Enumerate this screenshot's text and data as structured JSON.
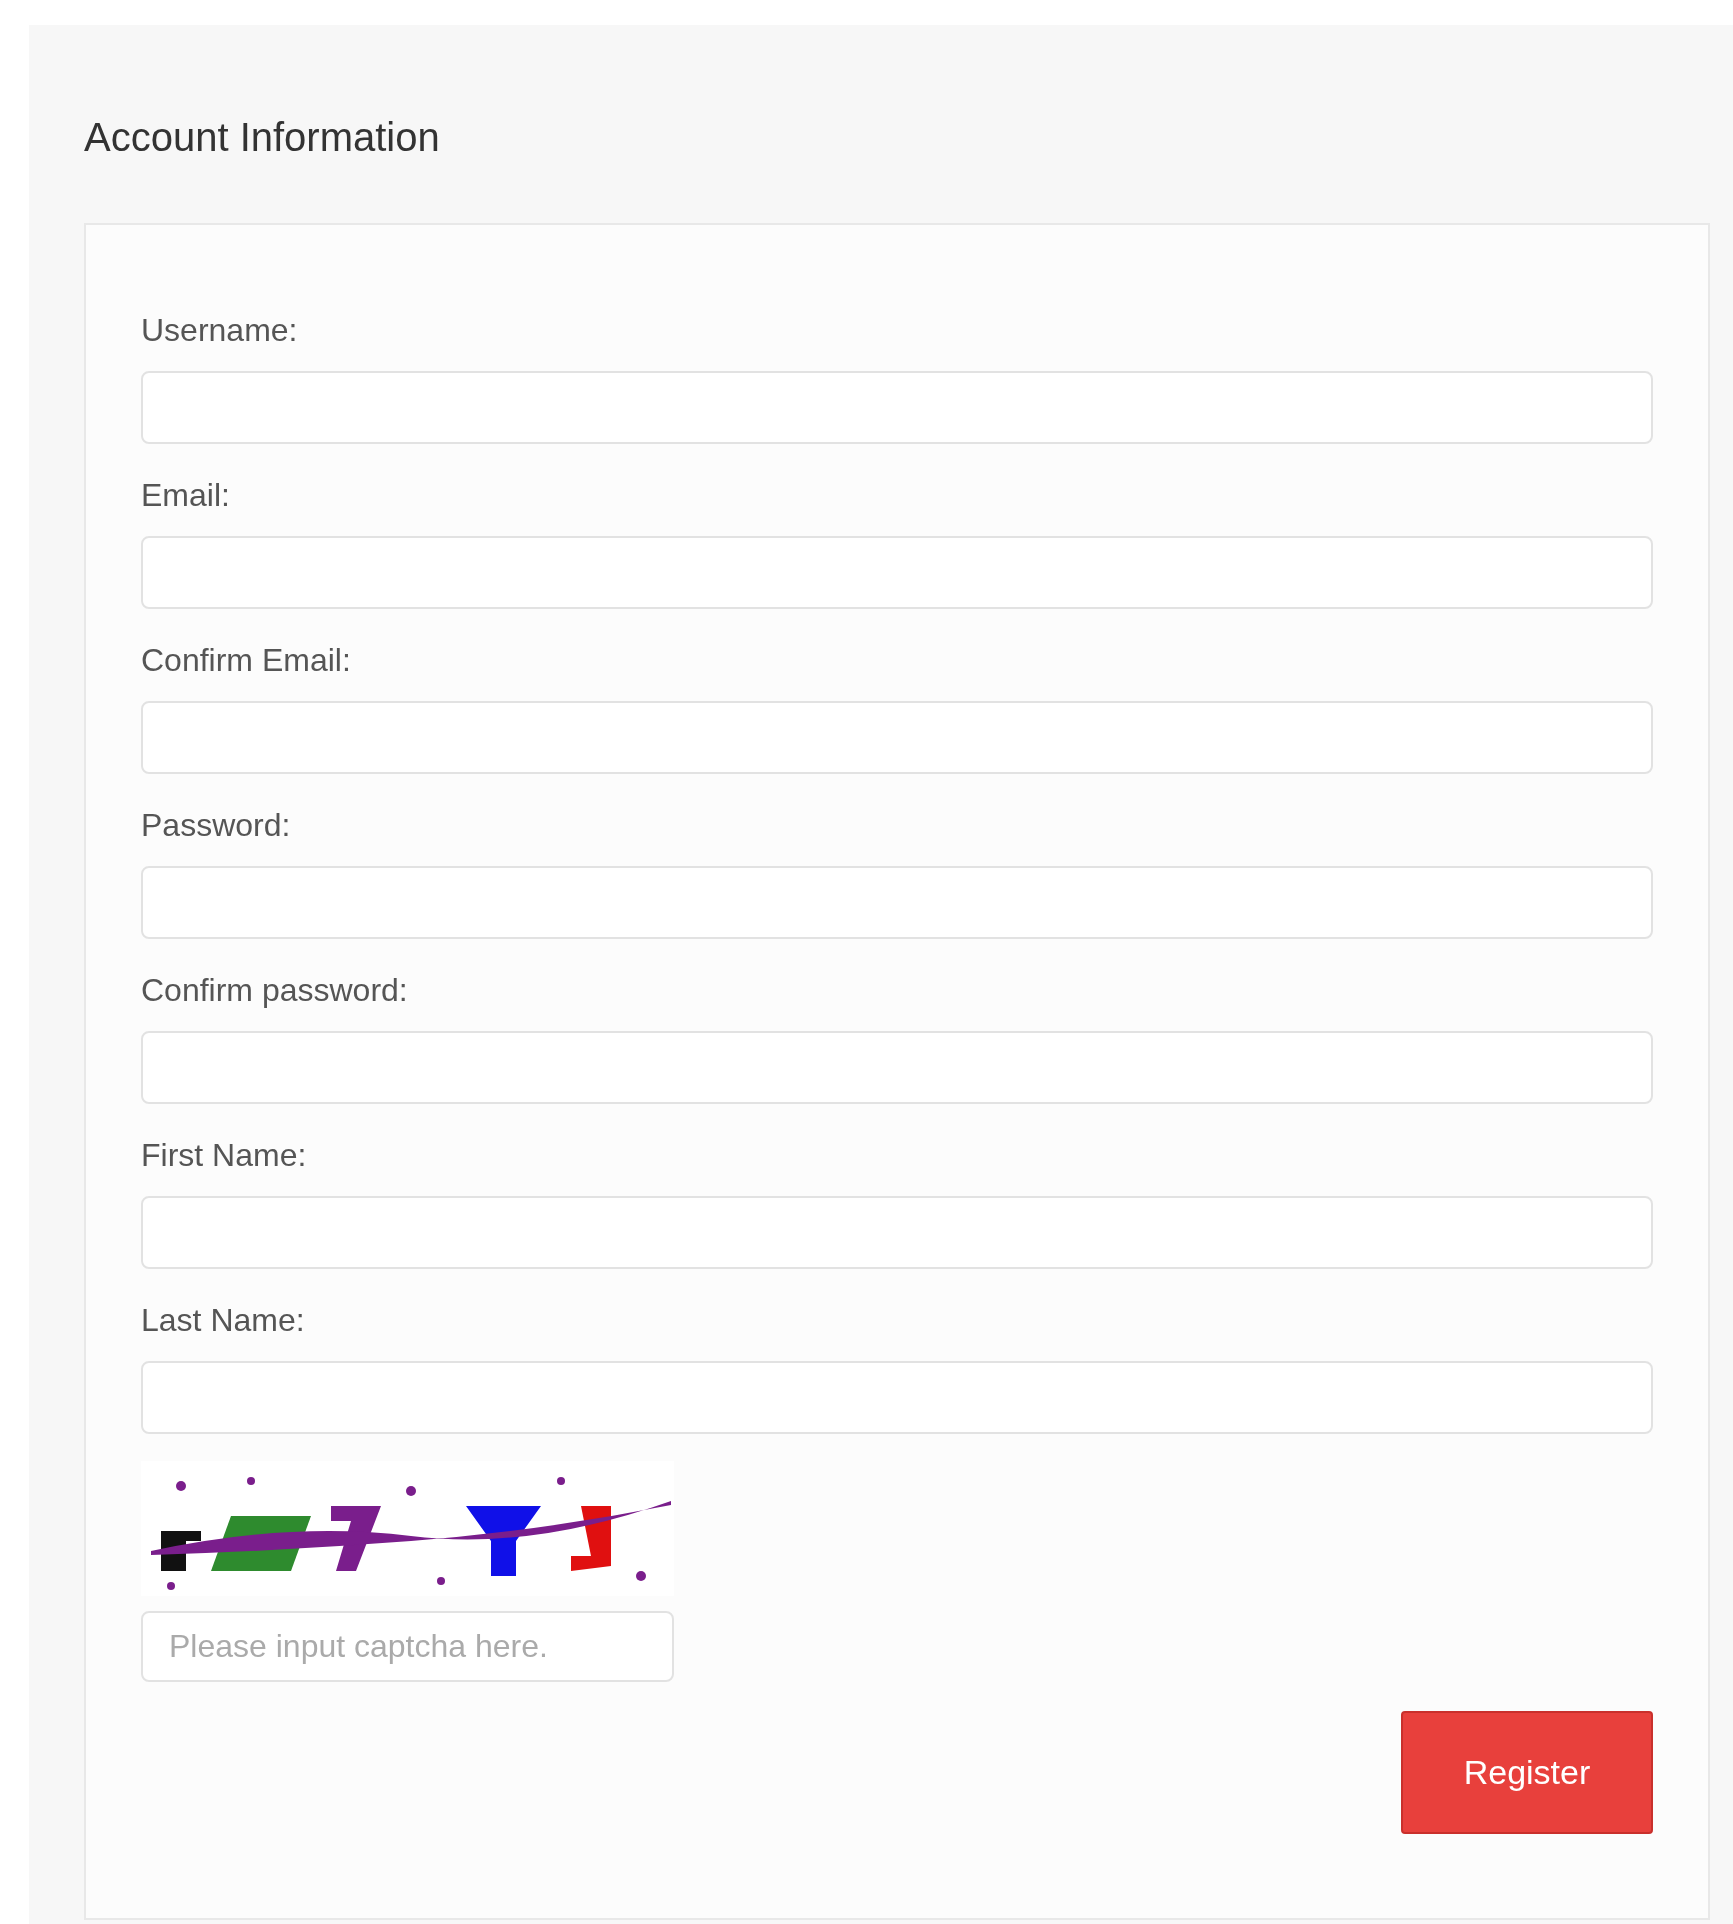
{
  "section": {
    "title": "Account Information"
  },
  "fields": [
    {
      "label": "Username:"
    },
    {
      "label": "Email:"
    },
    {
      "label": "Confirm Email:"
    },
    {
      "label": "Password:"
    },
    {
      "label": "Confirm password:"
    },
    {
      "label": "First Name:"
    },
    {
      "label": "Last Name:"
    }
  ],
  "captcha": {
    "placeholder": "Please input captcha here."
  },
  "buttons": [
    {
      "label": "Register"
    }
  ]
}
